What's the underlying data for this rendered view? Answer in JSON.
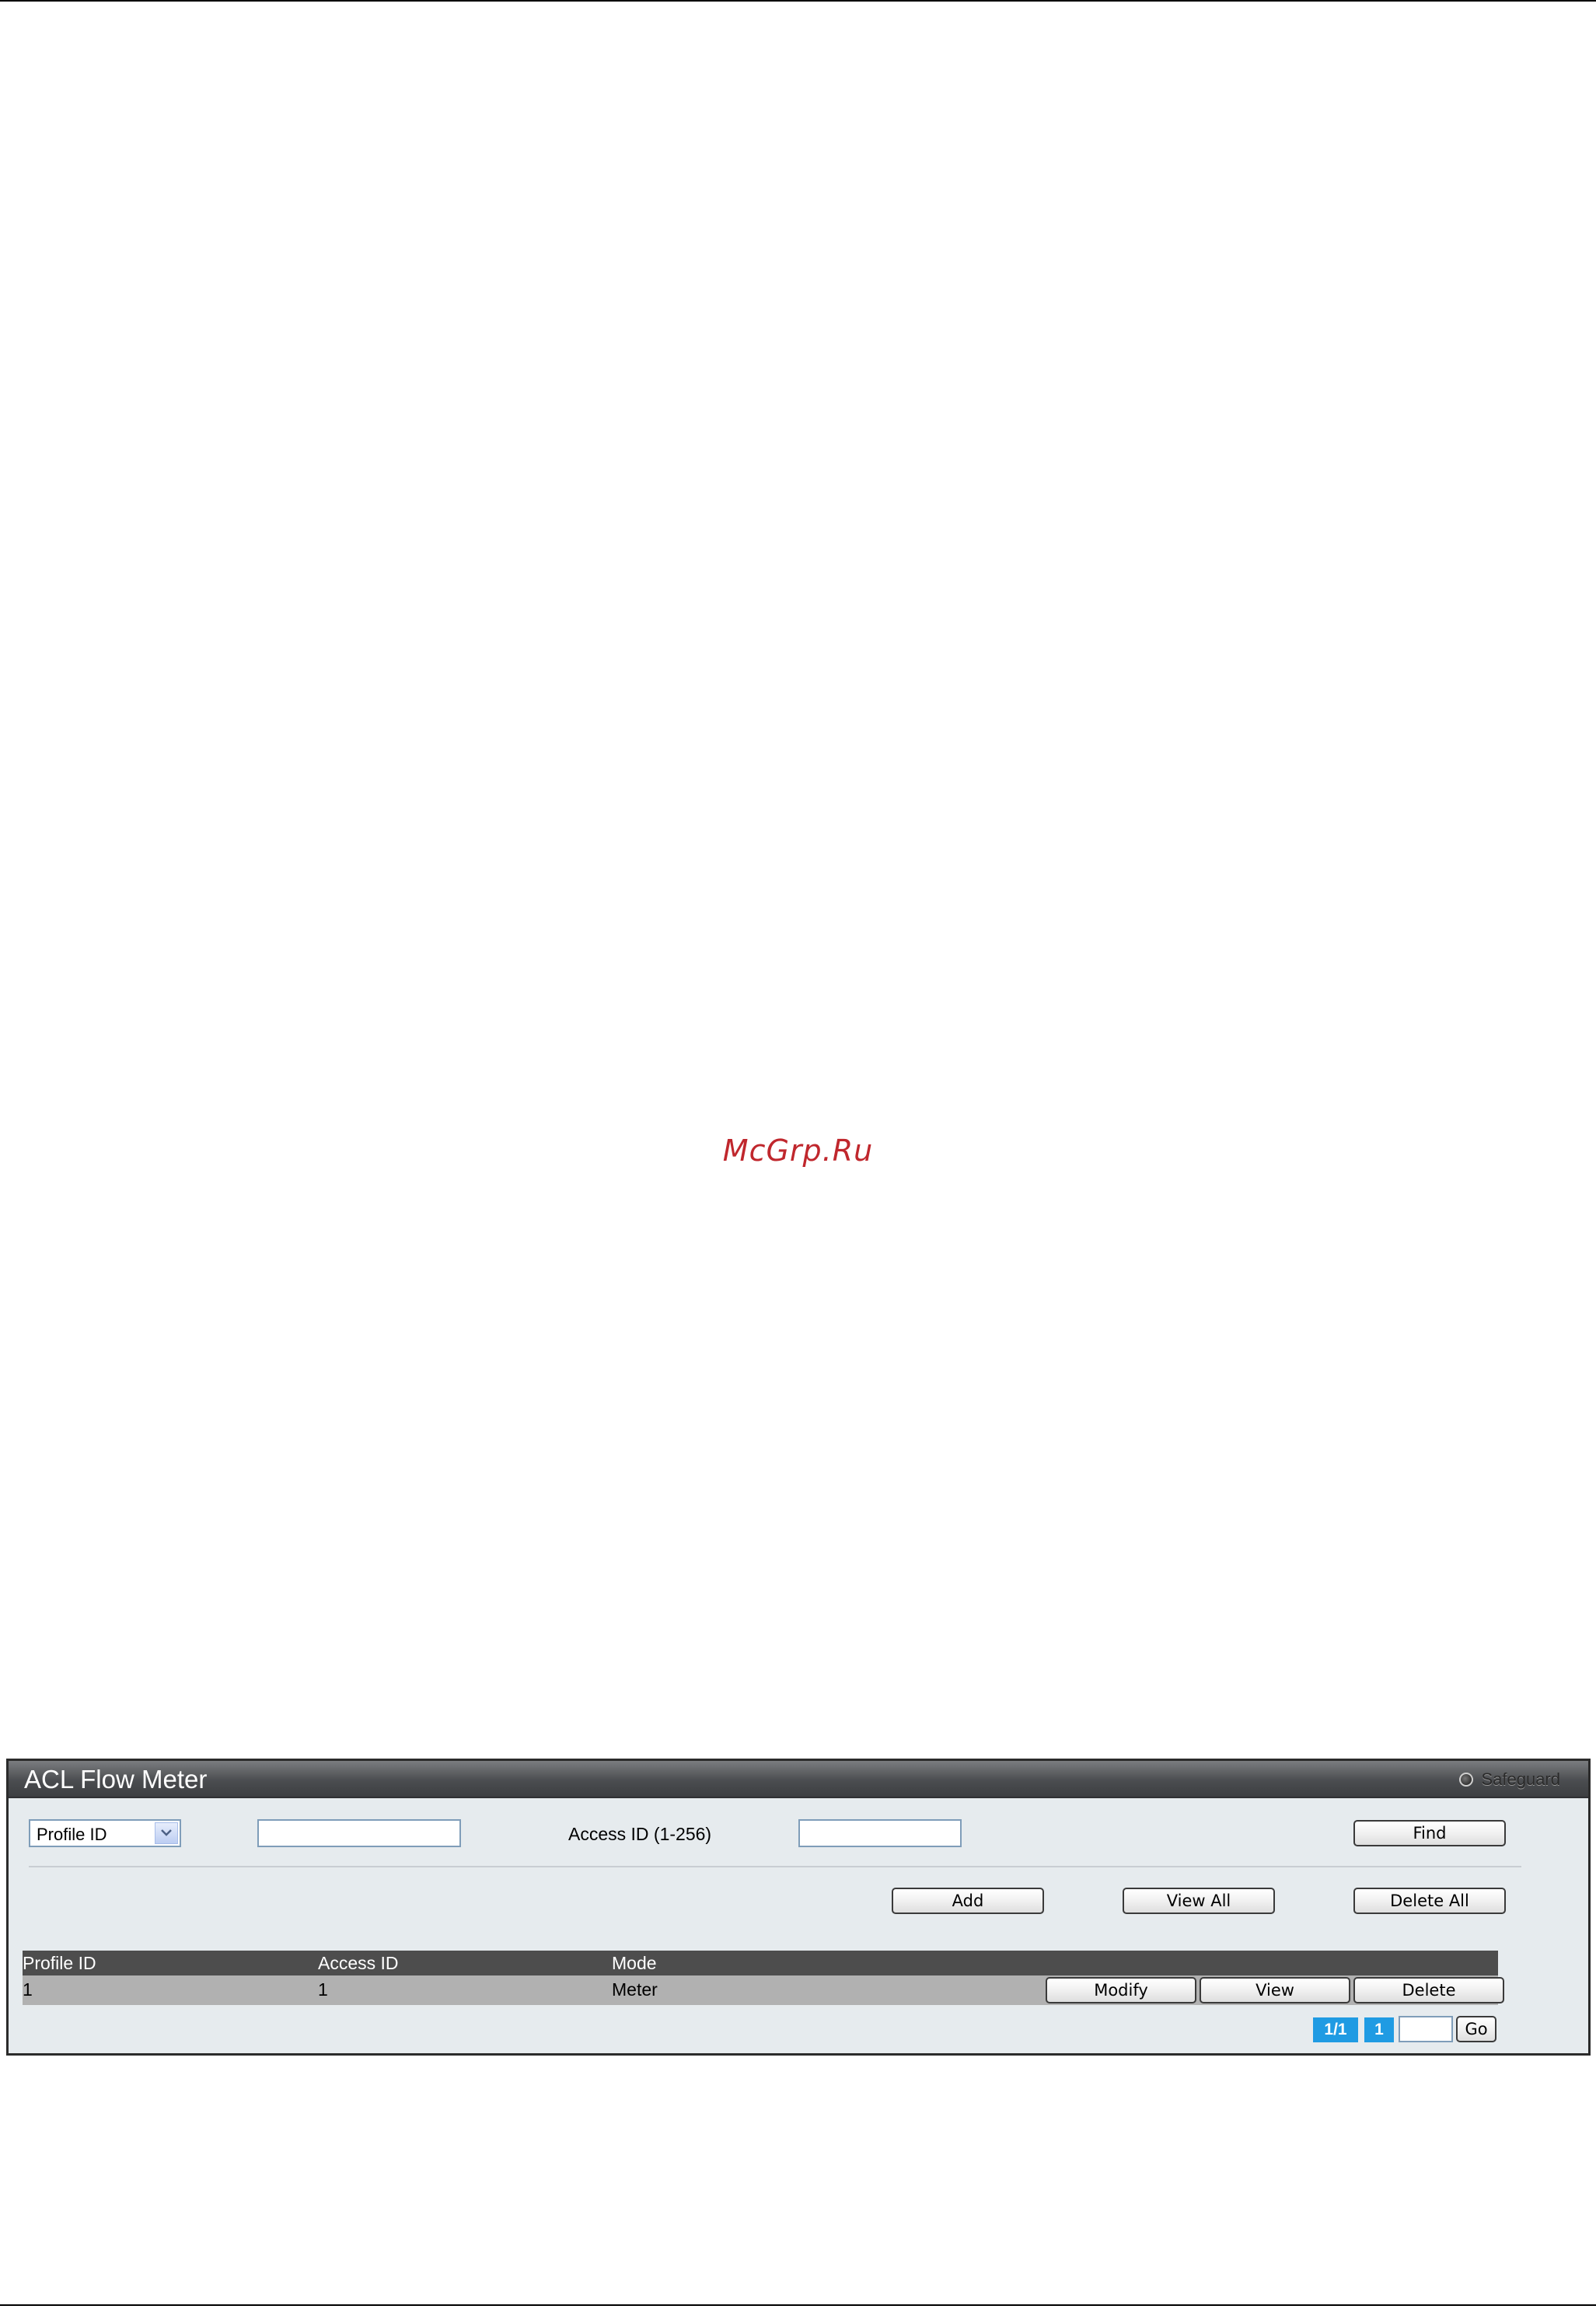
{
  "watermark": "McGrp.Ru",
  "panel": {
    "title": "ACL Flow Meter",
    "safeguard_label": "Safeguard"
  },
  "search": {
    "select_value": "Profile ID",
    "profile_value": "",
    "access_label": "Access ID (1-256)",
    "access_value": "",
    "find_label": "Find"
  },
  "actions": {
    "add_label": "Add",
    "view_all_label": "View All",
    "delete_all_label": "Delete All"
  },
  "table": {
    "columns": [
      "Profile ID",
      "Access ID",
      "Mode"
    ],
    "rows": [
      {
        "profile_id": "1",
        "access_id": "1",
        "mode": "Meter",
        "modify_label": "Modify",
        "view_label": "View",
        "delete_label": "Delete"
      }
    ]
  },
  "pagination": {
    "page_count": "1/1",
    "current_page": "1",
    "go_value": "",
    "go_label": "Go"
  },
  "colors": {
    "header_bg": "#4d4d4d",
    "row_bg": "#b1b1b1",
    "panel_bg": "#e6ebee",
    "page_badge": "#1f9be3",
    "watermark": "#c0272d"
  }
}
